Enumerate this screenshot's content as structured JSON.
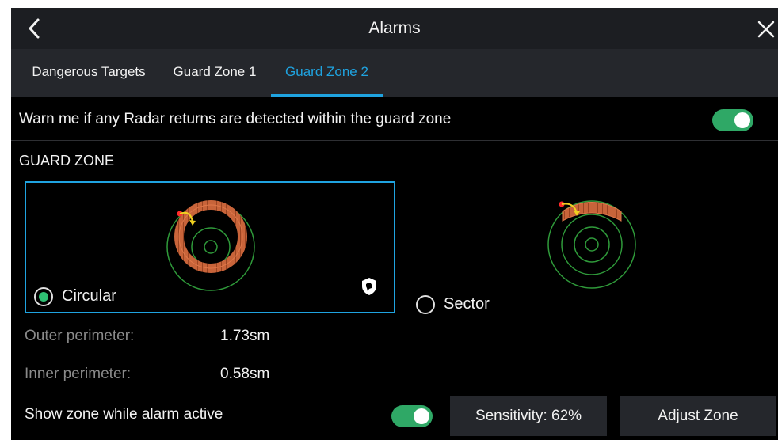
{
  "header": {
    "title": "Alarms"
  },
  "tabs": [
    {
      "label": "Dangerous Targets",
      "active": false
    },
    {
      "label": "Guard Zone 1",
      "active": false
    },
    {
      "label": "Guard Zone 2",
      "active": true
    }
  ],
  "warn": {
    "label": "Warn me if any Radar returns are detected within the guard zone",
    "enabled": true
  },
  "guard_zone": {
    "section_label": "GUARD ZONE",
    "options": [
      {
        "label": "Circular",
        "selected": true
      },
      {
        "label": "Sector",
        "selected": false
      }
    ]
  },
  "fields": {
    "outer_label": "Outer perimeter:",
    "outer_value": "1.73sm",
    "inner_label": "Inner perimeter:",
    "inner_value": "0.58sm"
  },
  "bottom": {
    "show_zone_label": "Show zone while alarm active",
    "show_zone_enabled": true,
    "sensitivity_label": "Sensitivity: 62%",
    "adjust_label": "Adjust Zone"
  },
  "colors": {
    "accent": "#1fa3e0",
    "toggle_on": "#2fa866",
    "zone_fill": "#c8643a",
    "range_rings": "#2f9a3a"
  }
}
